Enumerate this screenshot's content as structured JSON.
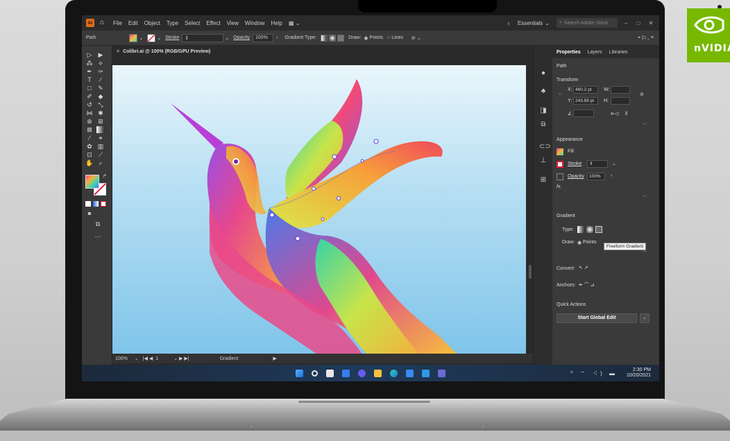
{
  "menubar": {
    "logo": "Ai",
    "items": [
      "File",
      "Edit",
      "Object",
      "Type",
      "Select",
      "Effect",
      "View",
      "Window",
      "Help"
    ],
    "workspace": "Essentials",
    "stock_placeholder": "Search Adobe Stock",
    "win": [
      "–",
      "□",
      "✕"
    ]
  },
  "control": {
    "path_label": "Path",
    "stroke_label": "Stroke",
    "opacity_label": "Opacity",
    "opacity_value": "100%",
    "gradient_type_label": "Gradient Type:",
    "draw_label": "Draw:",
    "points_label": "Points",
    "lines_label": "Lines"
  },
  "document": {
    "tab": "Colibri.ai @ 100% (RGB/GPU Preview)"
  },
  "status": {
    "zoom": "100%",
    "page": "1",
    "tool": "Gradient"
  },
  "panel": {
    "tabs": [
      "Properties",
      "Layers",
      "Libraries"
    ],
    "selection": "Path",
    "transform_title": "Transform",
    "x_label": "X:",
    "x_value": "460.2 pt",
    "y_label": "Y:",
    "y_value": "243.89 pt",
    "w_label": "W:",
    "h_label": "H:",
    "appearance_title": "Appearance",
    "fill_label": "Fill",
    "stroke_label": "Stroke",
    "opacity_label": "Opacity",
    "opacity_value": "100%",
    "fx": "fx.",
    "gradient_title": "Gradient",
    "type_label": "Type:",
    "draw_label": "Draw:",
    "points_label": "Points",
    "tooltip": "Freeform Gradient",
    "convert_label": "Convert:",
    "anchors_label": "Anchors:",
    "quick_actions_title": "Quick Actions",
    "global_edit_button": "Start Global Edit",
    "more": "..."
  },
  "taskbar": {
    "time": "2:30 PM",
    "date": "10/20/2021"
  },
  "brand": {
    "name": "nVIDIA",
    "color": "#76b900"
  },
  "colors": {
    "accent": "#e06c1b",
    "panel": "#3a3a3a"
  }
}
